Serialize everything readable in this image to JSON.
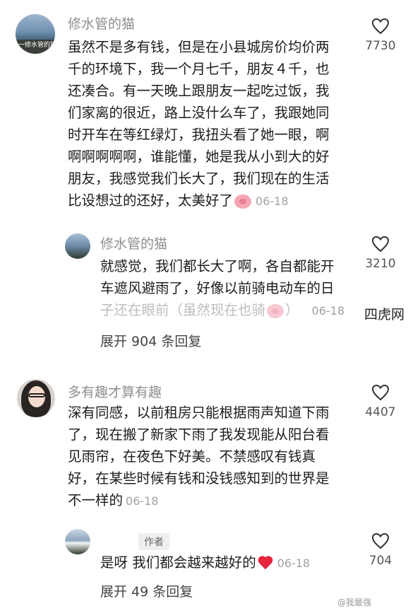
{
  "comments": [
    {
      "name": "修水管的猫",
      "avatar_text": "一修水管的猫",
      "lines": [
        "虽然不是多有钱，但是在小县城房价均价两",
        "千的环境下，我一个月七千，朋友４千，也",
        "还凑合。有一天晚上跟朋友一起吃过饭，我",
        "们家离的很近，路上没什么车了，我跟她同",
        "时开车在等红绿灯，我扭头看了她一眼，啊",
        "啊啊啊啊啊，谁能懂，她是我从小到大的好",
        "朋友，我感觉我们长大了，我们现在的生活",
        "比设想过的还好，太美好了"
      ],
      "date": "06-18",
      "likes": "7730"
    },
    {
      "name": "修水管的猫",
      "lines": [
        "就感觉，我们都长大了啊，各自都能开",
        "车遮风避雨了，好像以前骑电动车的日",
        "子还在眼前（虽然现在也骑"
      ],
      "date": "06-18",
      "likes": "3210"
    },
    {
      "name": "多有趣才算有趣",
      "lines": [
        "深有同感，以前租房只能根据雨声知道下雨",
        "了，现在搬了新家下雨了我发现能从阳台看",
        "见雨帘，在夜色下好美。不禁感叹有钱真",
        "好，在某些时候有钱和没钱感知到的世界是",
        "不一样的"
      ],
      "date": "06-18",
      "likes": "4407"
    },
    {
      "tag": "作者",
      "lines": [
        "是呀 我们都会越来越好的"
      ],
      "date": "06-18",
      "likes": "704"
    }
  ],
  "reply_paren_close": "）",
  "expand1": "展开 904 条回复",
  "expand2": "展开 49 条回复",
  "side_mark": "四虎网",
  "watermark": "@我最强",
  "colors": {
    "heart_red": "#e8243d",
    "pig_pink": "#f5a6b5",
    "meta_gray": "#8e8e8e"
  },
  "icons": {
    "like": "heart-outline-icon",
    "emoji1": "pig-emoji-icon",
    "emoji2": "heart-emoji-icon"
  }
}
